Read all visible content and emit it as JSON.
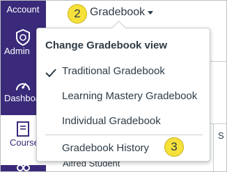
{
  "global_nav": {
    "items": [
      {
        "label": "Account",
        "icon": "account-icon"
      },
      {
        "label": "Admin",
        "icon": "admin-shield-icon"
      },
      {
        "label": "Dashboard",
        "icon": "dashboard-gauge-icon"
      },
      {
        "label": "Courses",
        "icon": "courses-book-icon"
      },
      {
        "label": "",
        "icon": "groups-icon"
      }
    ]
  },
  "header": {
    "gradebook_label": "Gradebook",
    "callout_2": "2",
    "callout_3": "3"
  },
  "menu": {
    "header": "Change Gradebook view",
    "items": [
      {
        "label": "Traditional Gradebook",
        "checked": true
      },
      {
        "label": "Learning Mastery Gradebook",
        "checked": false
      },
      {
        "label": "Individual Gradebook",
        "checked": false
      },
      {
        "label": "Gradebook History",
        "checked": false
      }
    ]
  },
  "background": {
    "student_name": "Alfred Student",
    "column_fragment": "S"
  },
  "colors": {
    "nav_bg": "#3b2a7a",
    "callout": "#f5e13a",
    "text": "#2d3b45"
  }
}
